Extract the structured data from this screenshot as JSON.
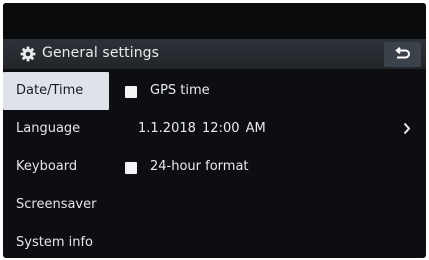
{
  "header": {
    "title": "General settings",
    "settings_icon": "gear-icon",
    "back_icon": "back-arrow-icon"
  },
  "sidebar": {
    "items": [
      {
        "label": "Date/Time",
        "selected": true
      },
      {
        "label": "Language",
        "selected": false
      },
      {
        "label": "Keyboard",
        "selected": false
      },
      {
        "label": "Screensaver",
        "selected": false
      },
      {
        "label": "System info",
        "selected": false
      }
    ]
  },
  "content": {
    "gps_time": {
      "label": "GPS time",
      "checked": false
    },
    "date_time": {
      "value": "1.1.2018  12:00 AM",
      "icon": "chevron-right-icon"
    },
    "hour_format": {
      "label": "24-hour format",
      "checked": false
    }
  },
  "colors": {
    "background": "#0c0e11",
    "header": "#2a2e33",
    "selected_item": "#dfe3e9",
    "text": "#e9ebee"
  }
}
